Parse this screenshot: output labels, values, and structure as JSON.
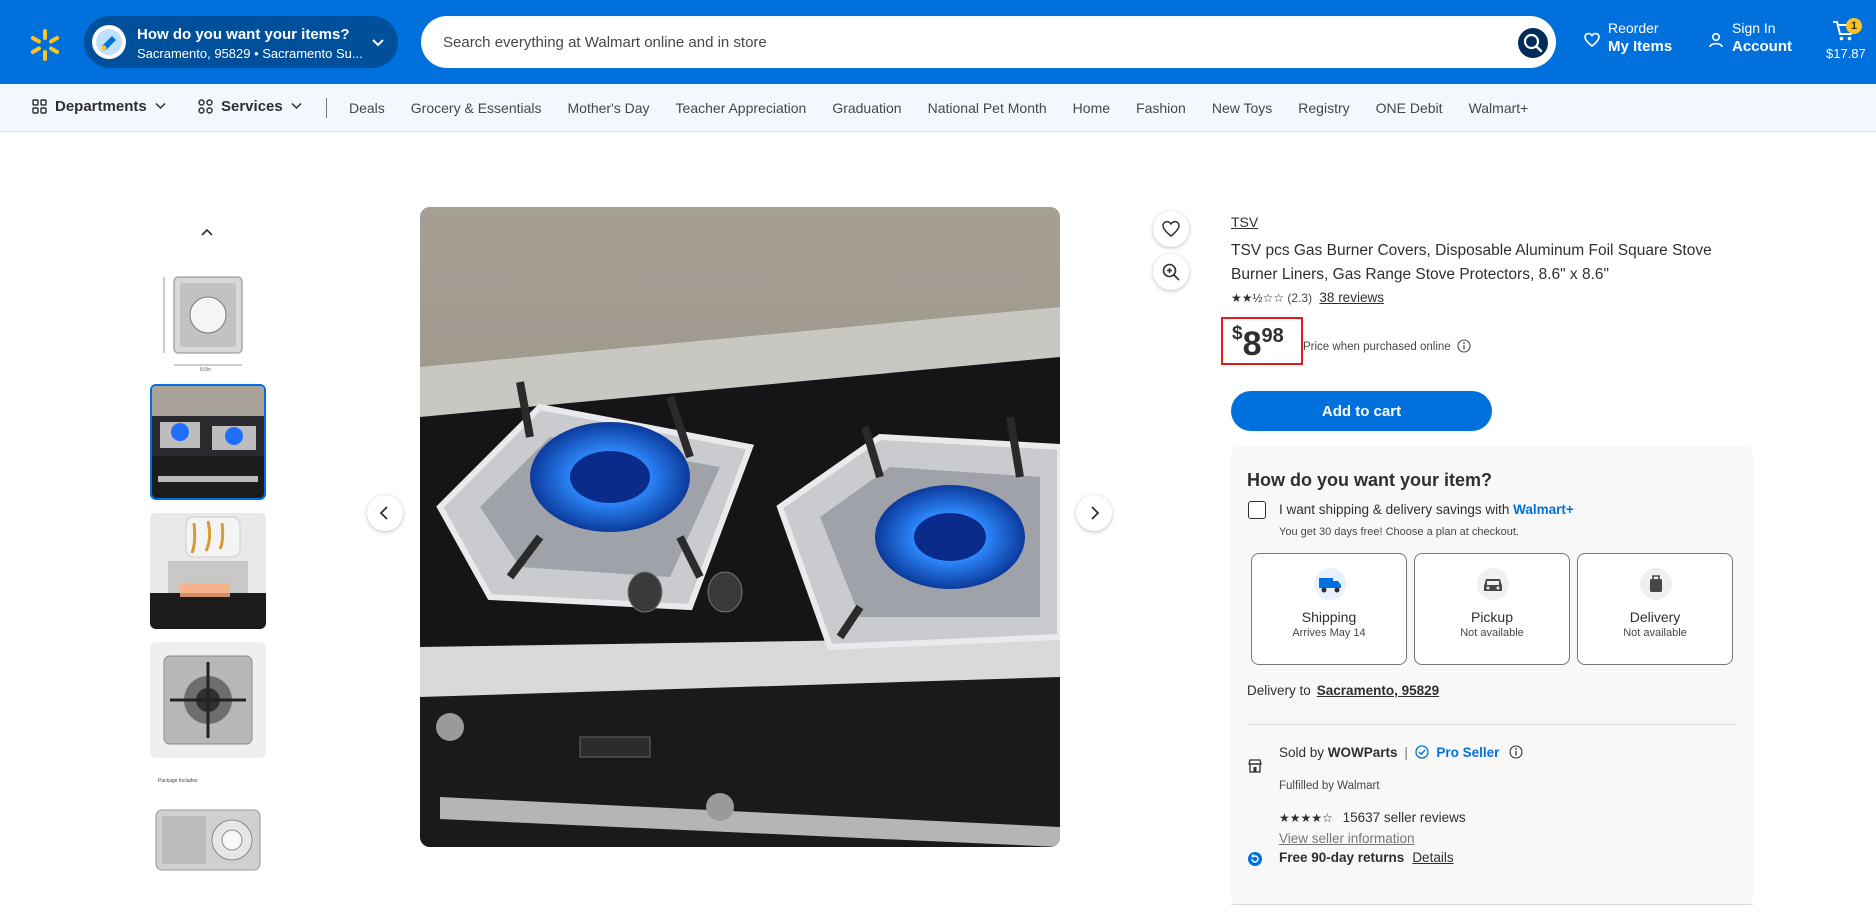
{
  "header": {
    "location_title": "How do you want your items?",
    "location_sub": "Sacramento, 95829 • Sacramento Su...",
    "search_placeholder": "Search everything at Walmart online and in store",
    "reorder_small": "Reorder",
    "reorder_big": "My Items",
    "signin_small": "Sign In",
    "signin_big": "Account",
    "cart_count": "1",
    "cart_total": "$17.87"
  },
  "nav": {
    "departments": "Departments",
    "services": "Services",
    "links": [
      "Deals",
      "Grocery & Essentials",
      "Mother's Day",
      "Teacher Appreciation",
      "Graduation",
      "National Pet Month",
      "Home",
      "Fashion",
      "New Toys",
      "Registry",
      "ONE Debit",
      "Walmart+"
    ]
  },
  "product": {
    "brand": "TSV",
    "title": "TSV pcs Gas Burner Covers, Disposable Aluminum Foil Square Stove Burner Liners, Gas Range Stove Protectors, 8.6\" x 8.6\"",
    "rating": "(2.3)",
    "reviews": "38 reviews",
    "price_currency": "$",
    "price_dollars": "8",
    "price_cents": "98",
    "price_note": "Price when purchased online",
    "add_to_cart": "Add to cart"
  },
  "fulfillment": {
    "title": "How do you want your item?",
    "wplus_text": "I want shipping & delivery savings with",
    "wplus_brand": "Walmart+",
    "wplus_sub": "You get 30 days free! Choose a plan at checkout.",
    "options": [
      {
        "label": "Shipping",
        "sub": "Arrives May 14"
      },
      {
        "label": "Pickup",
        "sub": "Not available"
      },
      {
        "label": "Delivery",
        "sub": "Not available"
      }
    ],
    "delivery_to": "Delivery to",
    "delivery_zip": "Sacramento, 95829",
    "sold_by": "Sold by",
    "seller": "WOWParts",
    "pro_seller": "Pro Seller",
    "fulfilled_by": "Fulfilled by Walmart",
    "seller_reviews": "15637 seller reviews",
    "view_seller": "View seller information",
    "returns": "Free 90-day returns",
    "details": "Details"
  },
  "thumb_labels": {
    "size_label": "8.6in",
    "package_label": "Package Includes"
  },
  "colors": {
    "walmart_blue": "#0071dc",
    "spark_yellow": "#ffc220",
    "price_box": "#e31b1b"
  }
}
